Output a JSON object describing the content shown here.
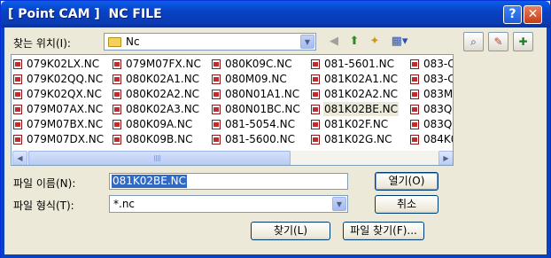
{
  "titlebar": {
    "title": "[ Point CAM ]  NC FILE",
    "help": "?",
    "close": "✕"
  },
  "toolbar": {
    "look_in_label": "찾는 위치(I):",
    "folder": "Nc",
    "back_icon": "back-arrow-icon",
    "up_icon": "up-folder-icon",
    "new_folder_icon": "new-folder-icon",
    "view_menu_icon": "view-menu-icon"
  },
  "side_buttons": [
    "preview-icon",
    "settings-icon",
    "info-icon"
  ],
  "files": [
    [
      "079K02LX.NC",
      "079K02QQ.NC",
      "079K02QX.NC",
      "079M07AX.NC",
      "079M07BX.NC",
      "079M07DX.NC"
    ],
    [
      "079M07FX.NC",
      "080K02A1.NC",
      "080K02A2.NC",
      "080K02A3.NC",
      "080K09A.NC",
      "080K09B.NC"
    ],
    [
      "080K09C.NC",
      "080M09.NC",
      "080N01A1.NC",
      "080N01BC.NC",
      "081-5054.NC",
      "081-5600.NC"
    ],
    [
      "081-5601.NC",
      "081K02A1.NC",
      "081K02A2.NC",
      "081K02BE.NC",
      "081K02F.NC",
      "081K02G.NC"
    ],
    [
      "083-C",
      "083-C",
      "083MI",
      "083Q0",
      "083Q0",
      "084K0"
    ]
  ],
  "selected_file": "081K02BE.NC",
  "form": {
    "name_label": "파일 이름(N):",
    "name_value": "081K02BE.NC",
    "type_label": "파일 형식(T):",
    "type_value": "*.nc"
  },
  "buttons": {
    "open": "열기(O)",
    "cancel": "취소",
    "find": "찾기(L)",
    "find_file": "파일 찾기(F)..."
  },
  "scrollbar": {
    "left": "◀",
    "right": "▶"
  }
}
